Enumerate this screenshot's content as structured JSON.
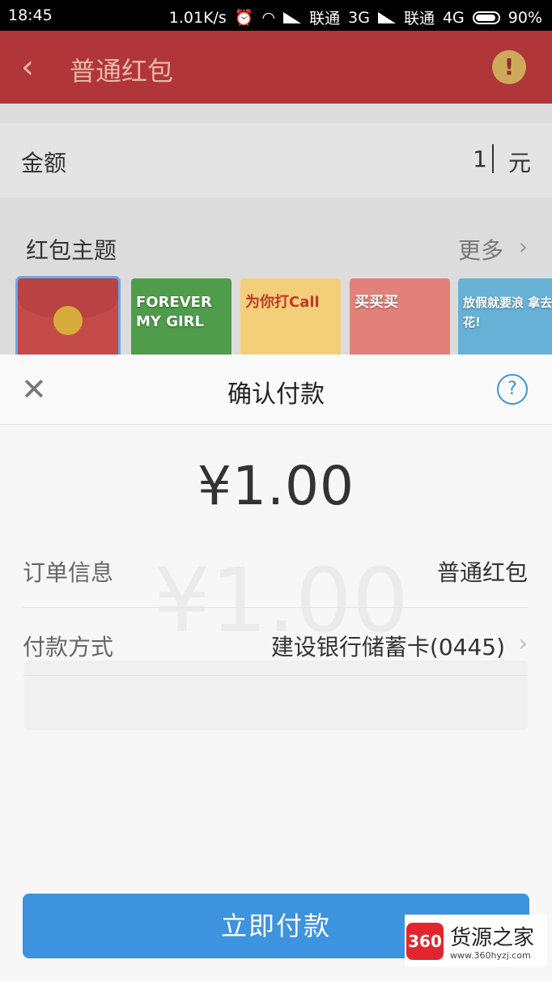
{
  "status_bar": {
    "time": "18:45",
    "net_speed": "1.01K/s",
    "carrier1": "联通",
    "net1": "3G",
    "carrier2": "联通",
    "net2": "4G",
    "battery": "90%"
  },
  "header": {
    "back_icon": "chevron-left",
    "title": "普通红包",
    "warn_icon": "exclamation",
    "warn_glyph": "!"
  },
  "background_form": {
    "amount_label": "金额",
    "amount_value": "1",
    "amount_unit": "元",
    "theme_title": "红包主题",
    "theme_more": "更多",
    "themes": [
      {
        "text": ""
      },
      {
        "text": "FOREVER MY GIRL"
      },
      {
        "text": "为你打Call"
      },
      {
        "text": "买买买"
      },
      {
        "text": "放假就要浪 拿去花!"
      }
    ]
  },
  "sheet": {
    "title": "确认付款",
    "amount": "¥1.00",
    "order_label": "订单信息",
    "order_value": "普通红包",
    "method_label": "付款方式",
    "method_value": "建设银行储蓄卡(0445)",
    "pay_button": "立即付款"
  },
  "watermark": {
    "logo": "360",
    "brand": "货源之家",
    "url": "www.360hyzj.com"
  },
  "colors": {
    "header_red": "#b0363a",
    "accent_blue": "#3d93dd",
    "coin_gold": "#d8ac3c"
  }
}
